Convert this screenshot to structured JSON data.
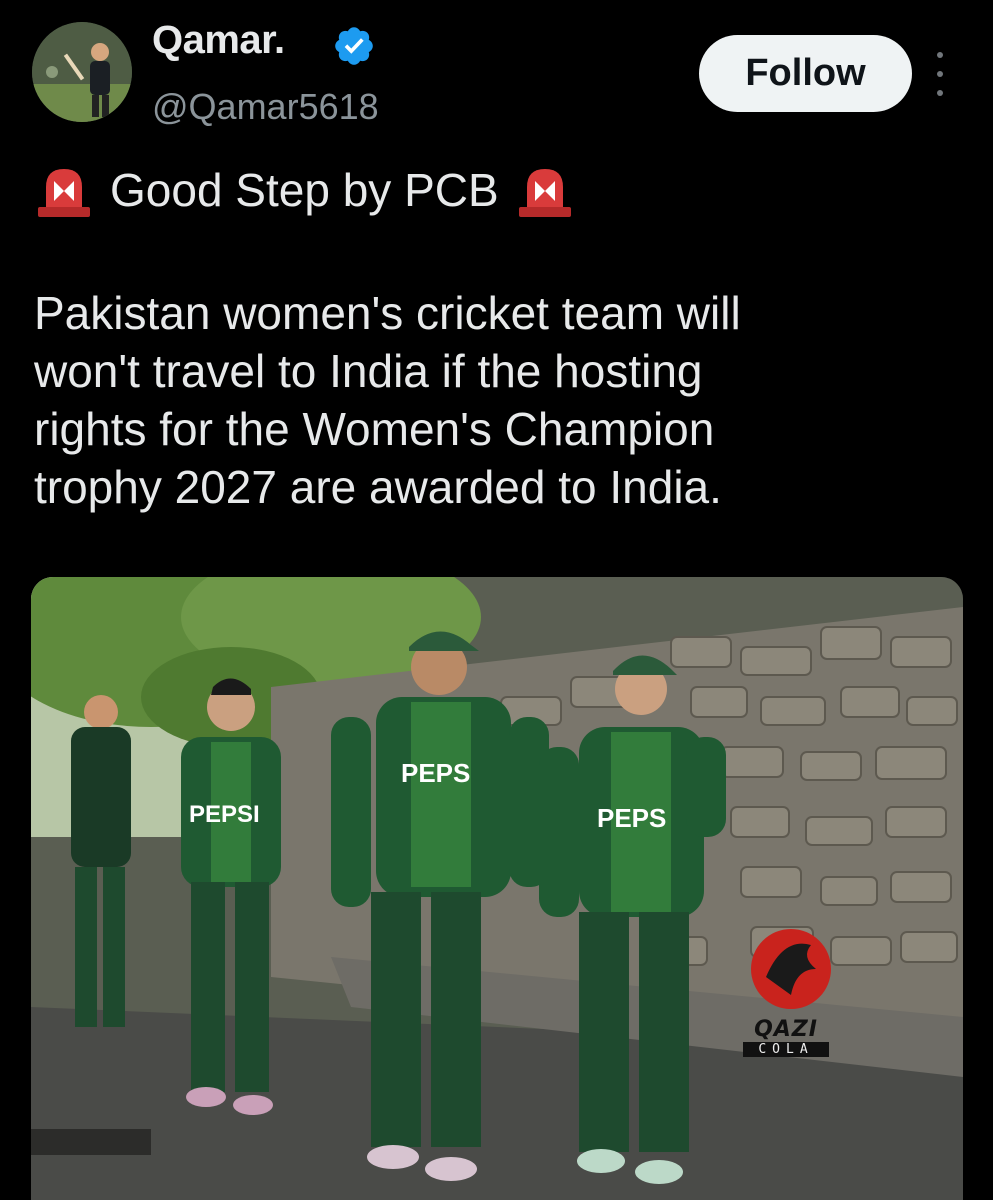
{
  "author": {
    "display_name": "Qamar.",
    "handle": "@Qamar5618",
    "verified": true
  },
  "actions": {
    "follow_label": "Follow"
  },
  "post": {
    "headline": "Good Step by PCB",
    "body": "Pakistan women's cricket team will\nwon't travel to India if the hosting\nrights for the Women's Champion\ntrophy 2027 are awarded to India."
  },
  "media": {
    "jersey_text": [
      "PEPS",
      "PEPSI",
      "PEPS"
    ],
    "sponsor_logo": "QAZI",
    "sponsor_subtext": "COLA"
  },
  "colors": {
    "background": "#000000",
    "text_primary": "#e7e9ea",
    "text_secondary": "#8b949a",
    "verified_blue": "#1d9bf0",
    "button_bg": "#eff3f4",
    "jersey_green": "#1f5a32",
    "siren_red": "#d93b3b"
  },
  "icons": [
    "verified-badge-icon",
    "siren-icon",
    "more-options-icon"
  ]
}
